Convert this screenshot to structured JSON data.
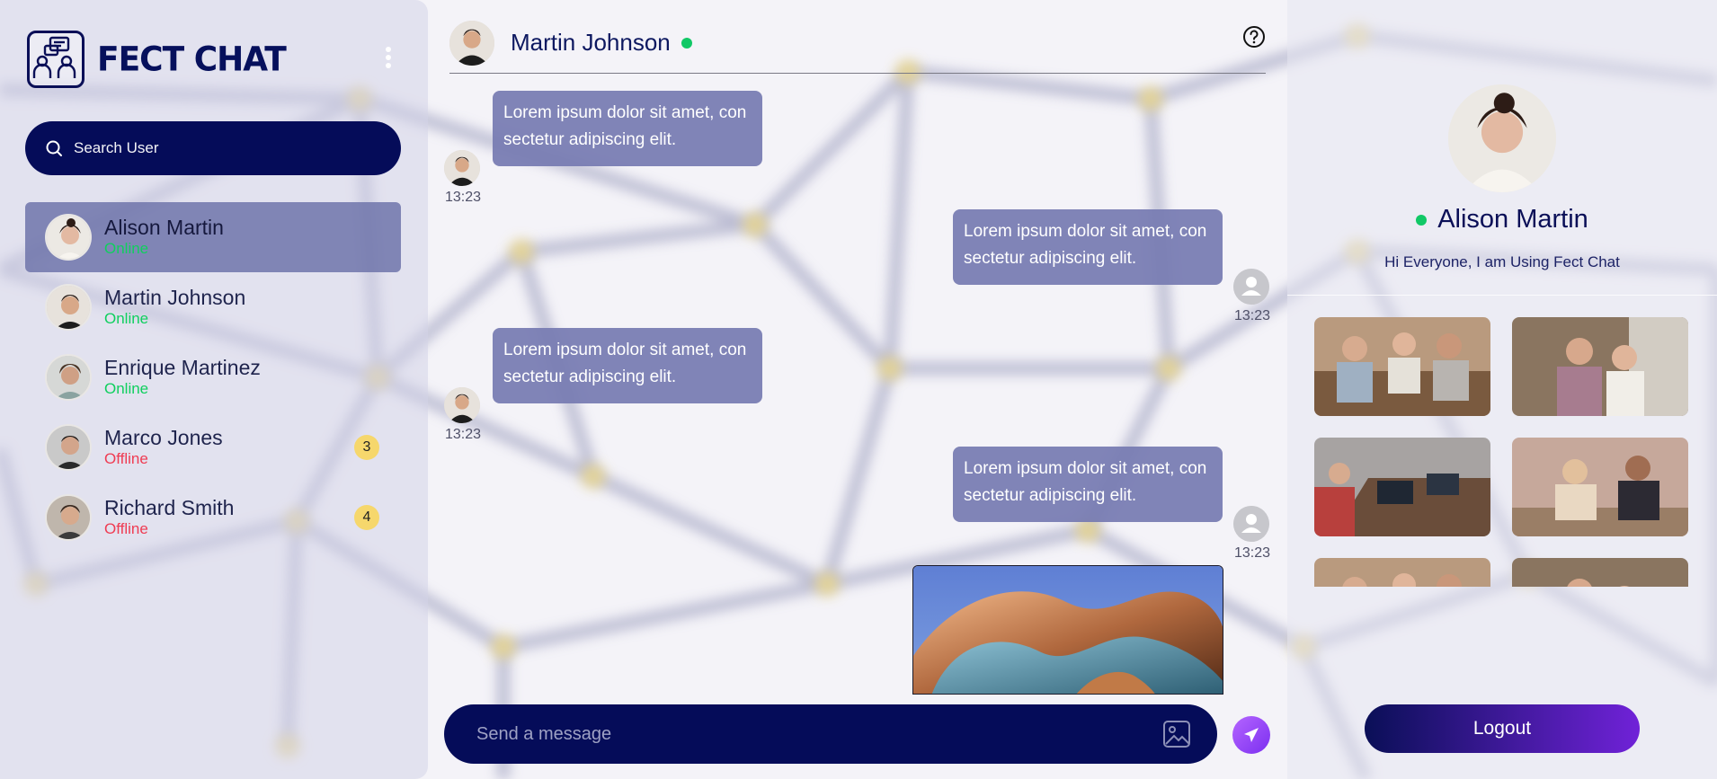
{
  "app": {
    "brand_name": "FECT CHAT"
  },
  "search": {
    "placeholder": "Search User"
  },
  "users": [
    {
      "name": "Alison Martin",
      "status": "Online",
      "active": true,
      "badge": ""
    },
    {
      "name": "Martin Johnson",
      "status": "Online",
      "active": false,
      "badge": ""
    },
    {
      "name": "Enrique Martinez",
      "status": "Online",
      "active": false,
      "badge": ""
    },
    {
      "name": "Marco Jones",
      "status": "Offline",
      "active": false,
      "badge": "3"
    },
    {
      "name": "Richard Smith",
      "status": "Offline",
      "active": false,
      "badge": "4"
    }
  ],
  "chat": {
    "contact_name": "Martin Johnson",
    "messages": [
      {
        "side": "received",
        "text": "Lorem ipsum dolor sit amet, consectetur adipiscing elit.",
        "time": "13:23"
      },
      {
        "side": "sent",
        "text": "Lorem ipsum dolor sit amet, consectetur adipiscing elit.",
        "time": "13:23"
      },
      {
        "side": "received",
        "text": "Lorem ipsum dolor sit amet, consectetur adipiscing elit.",
        "time": "13:23"
      },
      {
        "side": "sent",
        "text": "Lorem ipsum dolor sit amet, consectetur adipiscing elit.",
        "time": "13:23"
      }
    ],
    "composer_placeholder": "Send a message"
  },
  "profile": {
    "name": "Alison Martin",
    "status_message": "Hi Everyone, I am Using Fect Chat",
    "logout_label": "Logout"
  },
  "colors": {
    "brand_navy": "#050c59",
    "online": "#0fcf5e",
    "offline": "#ef3b52",
    "badge": "#f6d76c",
    "bubble": "#767bb2",
    "accent_purple": "#7b2ff0"
  }
}
